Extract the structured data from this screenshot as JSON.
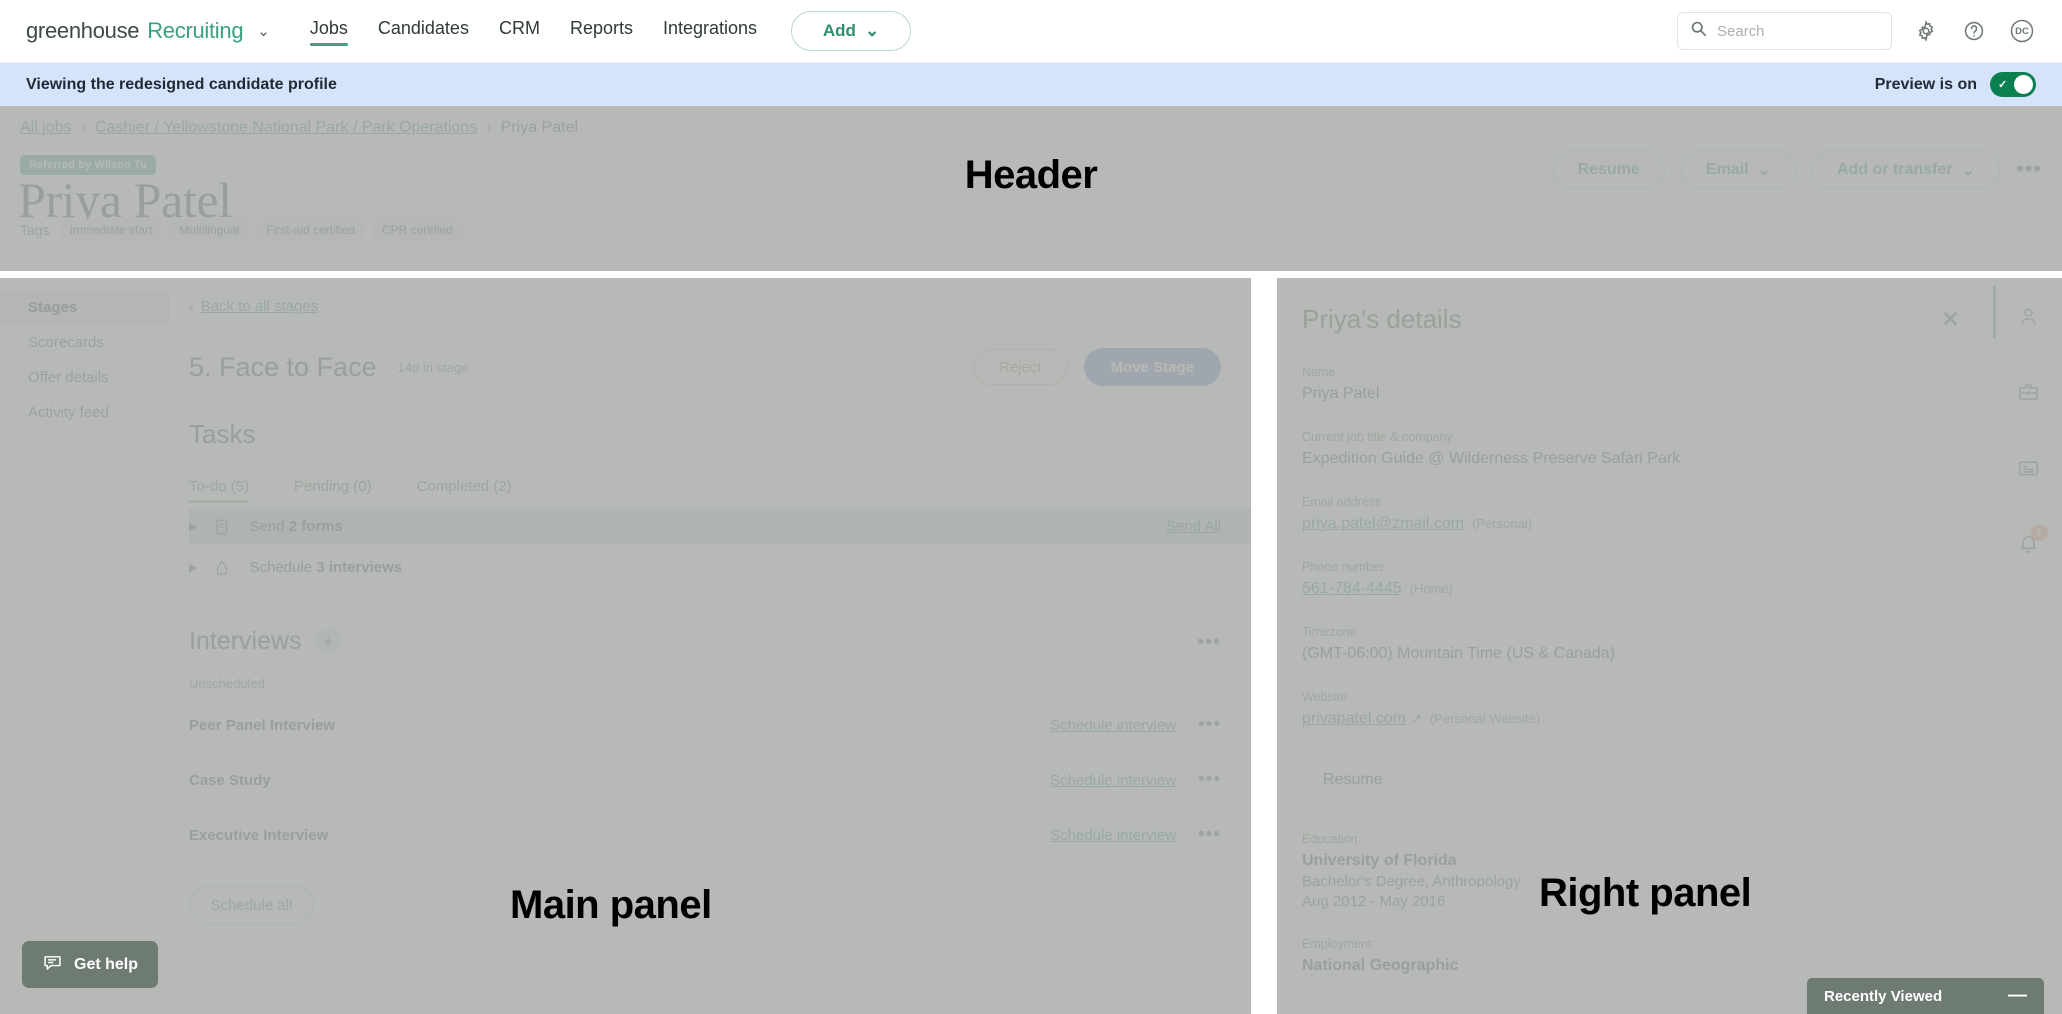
{
  "topnav": {
    "brand_primary": "greenhouse",
    "brand_secondary": "Recruiting",
    "brand_caret": "⌄",
    "links": [
      {
        "label": "Jobs",
        "active": true
      },
      {
        "label": "Candidates",
        "active": false
      },
      {
        "label": "CRM",
        "active": false
      },
      {
        "label": "Reports",
        "active": false
      },
      {
        "label": "Integrations",
        "active": false
      }
    ],
    "add_button": "Add",
    "add_caret": "⌄",
    "search_placeholder": "Search",
    "search_value": "",
    "icons": [
      "search-icon",
      "gear-icon",
      "help-icon",
      "avatar-dc"
    ],
    "avatar_initials": "DC"
  },
  "preview_banner": {
    "message": "Viewing the redesigned candidate profile",
    "toggle_label": "Preview is on",
    "toggle_on": true,
    "bg": "#d6e4fb",
    "toggle_color": "#0a8050"
  },
  "overlay_labels": {
    "header": "Header",
    "main": "Main panel",
    "right": "Right panel"
  },
  "header": {
    "breadcrumb": {
      "all_jobs": "All jobs",
      "sep": "›",
      "job": "Cashier / Yellowstone National Park / Park Operations",
      "current": "Priya Patel"
    },
    "referral_badge": "Referred by Wilson Tu",
    "candidate_name": "Priya Patel",
    "tags_label": "Tags",
    "tags": [
      "Immediate start",
      "Multilingual",
      "First-aid certified",
      "CPR certified"
    ],
    "actions": [
      {
        "label": "Resume",
        "caret": ""
      },
      {
        "label": "Email",
        "caret": "⌄"
      },
      {
        "label": "Add or transfer",
        "caret": "⌄"
      }
    ],
    "kebab": "•••"
  },
  "main": {
    "sidebar": [
      {
        "label": "Stages",
        "active": true
      },
      {
        "label": "Scorecards",
        "active": false
      },
      {
        "label": "Offer details",
        "active": false
      },
      {
        "label": "Activity feed",
        "active": false
      }
    ],
    "back_link": "Back to all stages",
    "back_chevron": "‹",
    "stage_title": "5. Face to Face",
    "stage_meta": "· 14d in stage",
    "reject_button": "Reject",
    "move_button": "Move Stage",
    "tasks_heading": "Tasks",
    "task_tabs": [
      {
        "label": "To-do (5)",
        "active": true
      },
      {
        "label": "Pending (0)",
        "active": false
      },
      {
        "label": "Completed (2)",
        "active": false
      }
    ],
    "tasks": [
      {
        "prefix": "Send",
        "strong": "2 forms",
        "icon": "forms-icon",
        "action": "Send All",
        "highlighted": true
      },
      {
        "prefix": "Schedule",
        "strong": "3 interviews",
        "icon": "interview-icon",
        "action": "",
        "highlighted": false
      }
    ],
    "interviews_heading": "Interviews",
    "interviews_add": "+",
    "interviews_kebab": "•••",
    "unscheduled_label": "Unscheduled",
    "interviews": [
      {
        "name": "Peer Panel Interview",
        "action": "Schedule interview"
      },
      {
        "name": "Case Study",
        "action": "Schedule interview"
      },
      {
        "name": "Executive Interview",
        "action": "Schedule interview"
      }
    ],
    "row_kebab": "•••",
    "schedule_all_button": "Schedule all"
  },
  "right_panel": {
    "title": "Priya's details",
    "close": "✕",
    "fields": [
      {
        "label": "Name",
        "value": "Priya Patel",
        "type": "text"
      },
      {
        "label": "Current job title & company",
        "value": "Expedition Guide @ Wilderness Preserve Safari Park",
        "type": "text"
      },
      {
        "label": "Email address",
        "value": "priya.patel@zmail.com",
        "note": "(Personal)",
        "type": "link"
      },
      {
        "label": "Phone number",
        "value": "561-784-4445",
        "note": "(Home)",
        "type": "link"
      },
      {
        "label": "Timezone",
        "value": "(GMT-06:00) Mountain Time (US & Canada)",
        "type": "text"
      },
      {
        "label": "Website",
        "value": "privapatel.com",
        "external": "↗",
        "note": "(Personal Website)",
        "type": "link"
      }
    ],
    "resume_box": "Resume",
    "education": {
      "label": "Education",
      "school": "University of Florida",
      "degree": "Bachelor's Degree, Anthropology",
      "dates": "Aug 2012 - May 2016"
    },
    "employment": {
      "label": "Employment",
      "company": "National Geographic"
    },
    "rail": [
      {
        "name": "person-icon",
        "active": true,
        "badge": ""
      },
      {
        "name": "briefcase-icon",
        "active": false,
        "badge": ""
      },
      {
        "name": "card-list-icon",
        "active": false,
        "badge": ""
      },
      {
        "name": "bell-icon",
        "active": false,
        "badge": "1"
      }
    ],
    "rail_badge_color": "#f0a182"
  },
  "floating": {
    "get_help": "Get help",
    "recently_viewed": "Recently Viewed",
    "recently_viewed_minimize": "—",
    "floater_bg": "#6e7b72"
  }
}
